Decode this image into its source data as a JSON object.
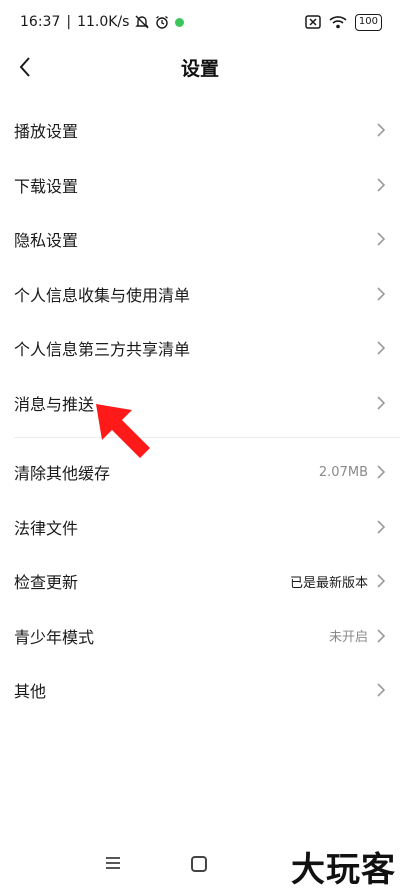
{
  "status": {
    "time": "16:37",
    "speed": "11.0K/s",
    "battery": "100"
  },
  "header": {
    "title": "设置"
  },
  "settings": [
    {
      "label": "播放设置"
    },
    {
      "label": "下载设置"
    },
    {
      "label": "隐私设置"
    },
    {
      "label": "个人信息收集与使用清单"
    },
    {
      "label": "个人信息第三方共享清单"
    },
    {
      "label": "消息与推送"
    }
  ],
  "more": [
    {
      "label": "清除其他缓存",
      "value": "2.07MB"
    },
    {
      "label": "法律文件"
    },
    {
      "label": "检查更新",
      "value": "已是最新版本"
    },
    {
      "label": "青少年模式",
      "value": "未开启"
    },
    {
      "label": "其他"
    }
  ],
  "watermark": "大玩客",
  "colors": {
    "accent_arrow": "#ff1a1a",
    "muted_text": "#8a8a8a"
  }
}
